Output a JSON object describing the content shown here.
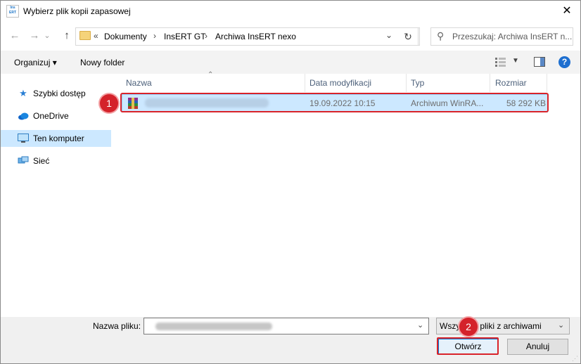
{
  "window": {
    "title": "Wybierz plik kopii zapasowej",
    "logo_text": "InsERT nexo"
  },
  "nav": {
    "back_glyph": "←",
    "forward_glyph": "→",
    "recent_glyph": "⌄",
    "up_glyph": "↑",
    "breadcrumb_prefix": "«",
    "breadcrumbs": [
      "Dokumenty",
      "InsERT GT",
      "Archiwa InsERT nexo"
    ],
    "breadcrumb_sep": "›",
    "refresh_glyph": "↻",
    "search_placeholder": "Przeszukaj: Archiwa InsERT n..."
  },
  "toolbar": {
    "organize_label": "Organizuj ▾",
    "new_folder_label": "Nowy folder",
    "help_glyph": "?"
  },
  "sidebar": {
    "items": [
      {
        "label": "Szybki dostęp",
        "icon": "star-icon"
      },
      {
        "label": "OneDrive",
        "icon": "cloud-icon"
      },
      {
        "label": "Ten komputer",
        "icon": "computer-icon",
        "selected": true
      },
      {
        "label": "Sieć",
        "icon": "network-icon"
      }
    ]
  },
  "filelist": {
    "columns": [
      "Nazwa",
      "Data modyfikacji",
      "Typ",
      "Rozmiar"
    ],
    "rows": [
      {
        "name": "",
        "modified": "19.09.2022 10:15",
        "type": "Archiwum WinRA...",
        "size": "58 292 KB",
        "icon": "rar-archive-icon"
      }
    ]
  },
  "bottom": {
    "filename_label": "Nazwa pliku:",
    "filename_value": "",
    "filetype_value": "Wszystkie pliki z archiwami",
    "open_label": "Otwórz",
    "cancel_label": "Anuluj"
  },
  "annotations": {
    "badge1": "1",
    "badge2": "2",
    "highlight_color": "#d9232a"
  },
  "colors": {
    "selection": "#cce8ff",
    "selection_border": "#99d1ff",
    "accent": "#0078d7"
  }
}
